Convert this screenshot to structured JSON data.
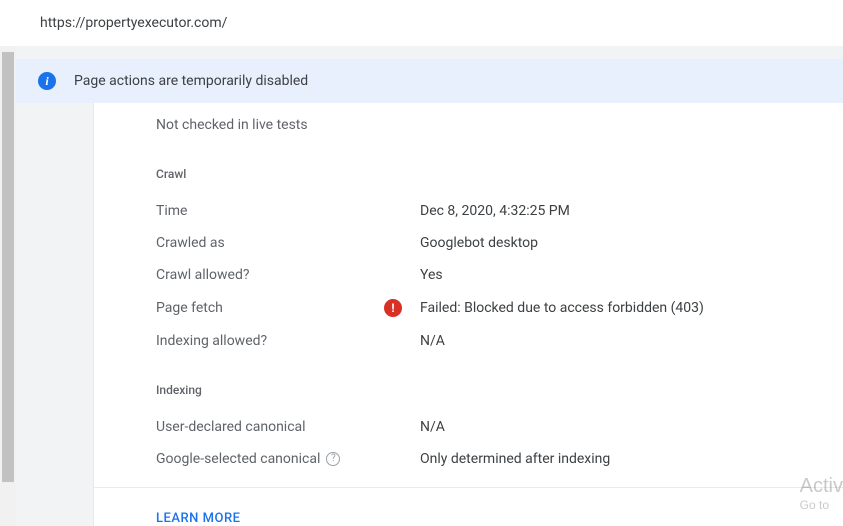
{
  "url_bar": {
    "url": "https://propertyexecutor.com/"
  },
  "notice": {
    "text": "Page actions are temporarily disabled"
  },
  "live_test_status": "Not checked in live tests",
  "sections": {
    "crawl": {
      "heading": "Crawl",
      "rows": {
        "time": {
          "label": "Time",
          "value": "Dec 8, 2020, 4:32:25 PM"
        },
        "crawled_as": {
          "label": "Crawled as",
          "value": "Googlebot desktop"
        },
        "crawl_allowed": {
          "label": "Crawl allowed?",
          "value": "Yes"
        },
        "page_fetch": {
          "label": "Page fetch",
          "value": "Failed: Blocked due to access forbidden (403)"
        },
        "indexing_allowed": {
          "label": "Indexing allowed?",
          "value": "N/A"
        }
      }
    },
    "indexing": {
      "heading": "Indexing",
      "rows": {
        "user_canonical": {
          "label": "User-declared canonical",
          "value": "N/A"
        },
        "google_canonical": {
          "label": "Google-selected canonical",
          "value": "Only determined after indexing"
        }
      }
    }
  },
  "learn_more": "LEARN MORE",
  "watermark": {
    "line1": "Activ",
    "line2": "Go to"
  }
}
